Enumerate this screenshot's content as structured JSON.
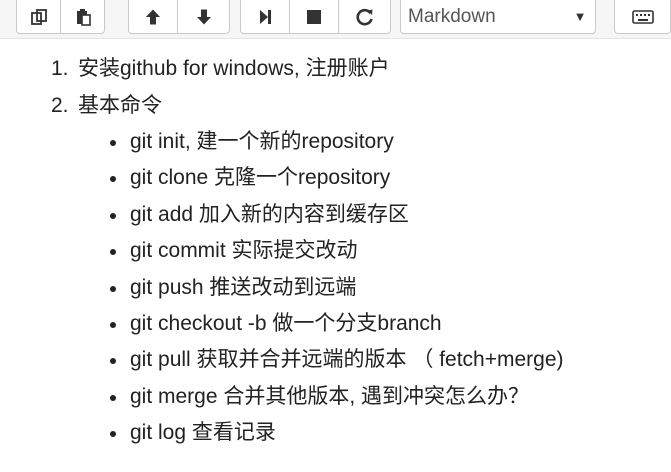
{
  "toolbar": {
    "buttons": [
      {
        "name": "copy-cell",
        "icon": "copy-icon"
      },
      {
        "name": "paste-cell",
        "icon": "paste-icon"
      },
      {
        "name": "move-up",
        "icon": "arrow-up-icon"
      },
      {
        "name": "move-down",
        "icon": "arrow-down-icon"
      },
      {
        "name": "run",
        "icon": "step-forward-icon"
      },
      {
        "name": "stop",
        "icon": "stop-icon"
      },
      {
        "name": "restart",
        "icon": "restart-icon"
      },
      {
        "name": "command-palette",
        "icon": "keyboard-icon"
      }
    ],
    "cell_type": {
      "value": "Markdown",
      "caret": "▼"
    }
  },
  "content": {
    "steps": [
      {
        "number": "1.",
        "text": "安装github for windows, 注册账户"
      },
      {
        "number": "2.",
        "text": "基本命令"
      }
    ],
    "commands": [
      "git init, 建一个新的repository",
      "git clone 克隆一个repository",
      "git add 加入新的内容到缓存区",
      "git commit 实际提交改动",
      "git push 推送改动到远端",
      "git checkout -b 做一个分支branch",
      "git pull 获取并合并远端的版本 （ fetch+merge)",
      "git merge 合并其他版本, 遇到冲突怎么办？",
      "git log 查看记录"
    ]
  },
  "colors": {
    "toolbar_bg": "#f6f6f6",
    "button_border": "#c9c9c9",
    "icon": "#333333",
    "text": "#222222"
  }
}
